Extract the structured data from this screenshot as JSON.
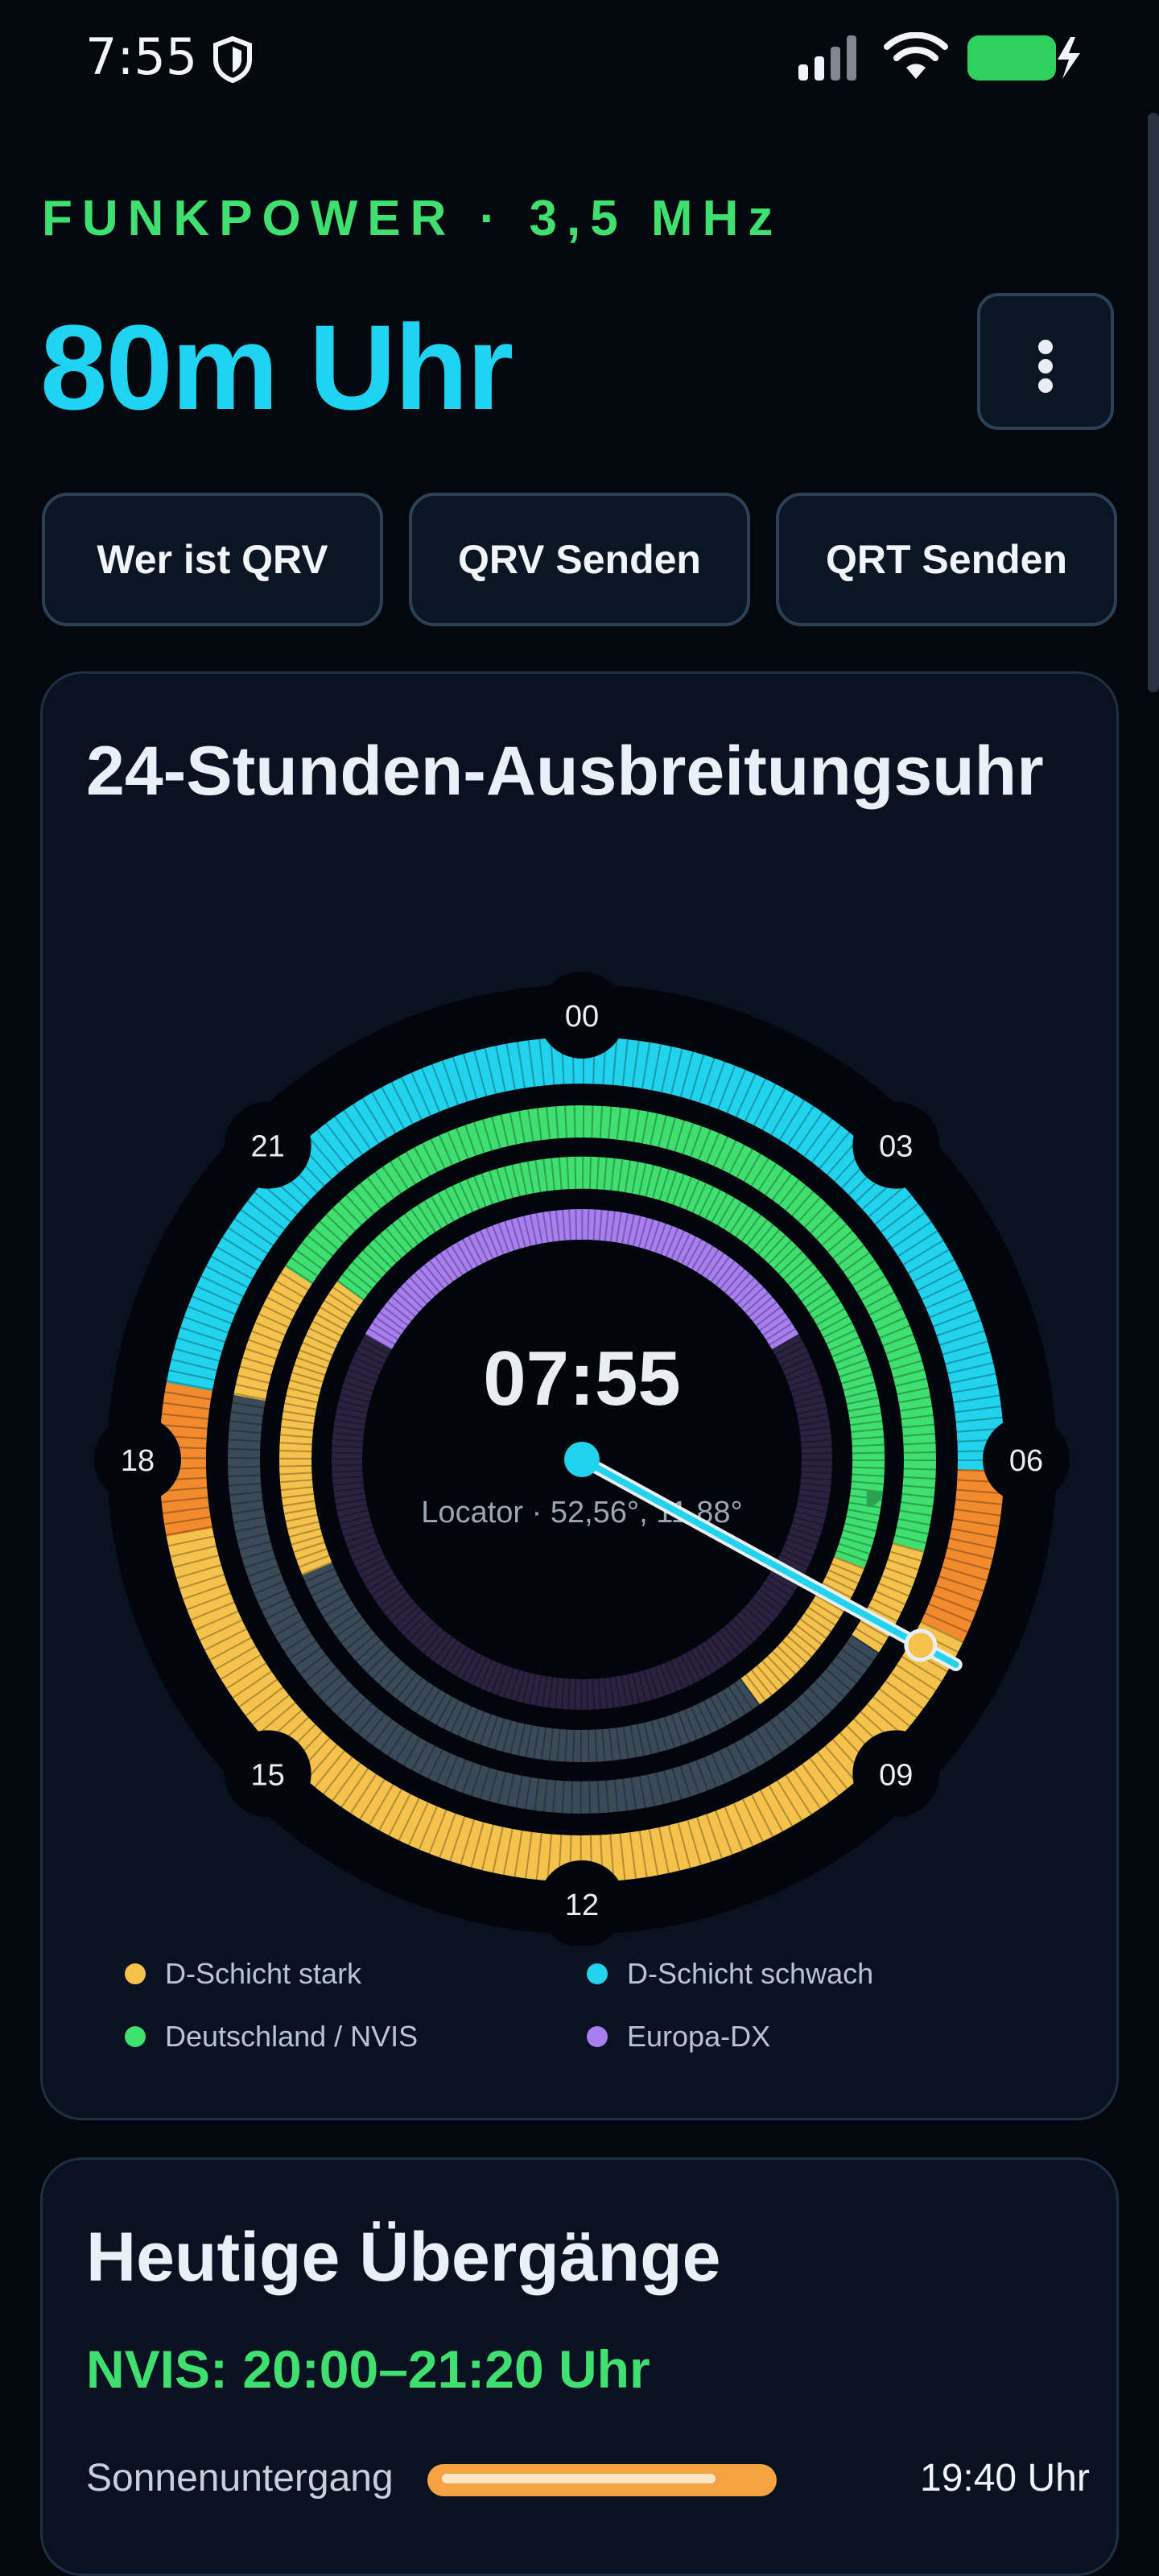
{
  "status_bar": {
    "time": "7:55",
    "icons": [
      "shield-icon",
      "signal-icon",
      "wifi-icon",
      "battery-charging-icon"
    ]
  },
  "header": {
    "eyebrow": "FUNKPOWER · 3,5 MHz",
    "title": "80m Uhr",
    "menu_icon": "more-vertical-icon"
  },
  "actions": [
    {
      "label": "Wer ist QRV"
    },
    {
      "label": "QRV Senden"
    },
    {
      "label": "QRT Senden"
    }
  ],
  "clock_card": {
    "title": "24-Stunden-Ausbreitungsuhr",
    "center_time": "07:55",
    "locator": "Locator · 52,56°, 11,88°",
    "hour_labels": [
      "00",
      "03",
      "06",
      "09",
      "12",
      "15",
      "18",
      "21"
    ],
    "needle_hour": 7.9167,
    "rings": [
      {
        "name": "D-Schicht-ring",
        "segments": [
          {
            "from": 18.7,
            "to": 6.1,
            "color": "#22d3ee"
          },
          {
            "from": 6.1,
            "to": 7.7,
            "color": "#f28a2e"
          },
          {
            "from": 7.7,
            "to": 17.3,
            "color": "#f5c34b"
          },
          {
            "from": 17.3,
            "to": 18.7,
            "color": "#f28a2e"
          }
        ]
      },
      {
        "name": "Deutschland-NVIS-ring",
        "segments": [
          {
            "from": 20.2,
            "to": 7.0,
            "color": "#3fe06f"
          },
          {
            "from": 7.0,
            "to": 8.2,
            "color": "#f5c34b"
          },
          {
            "from": 8.2,
            "to": 17.4,
            "color": "#3a4a59"
          },
          {
            "from": 17.4,
            "to": 18.7,
            "color": "#3a4a59"
          },
          {
            "from": 18.7,
            "to": 20.2,
            "color": "#f5c34b"
          }
        ]
      },
      {
        "name": "Inland-ring",
        "segments": [
          {
            "from": 20.4,
            "to": 7.4,
            "color": "#3fe06f"
          },
          {
            "from": 7.4,
            "to": 9.6,
            "color": "#f5c34b"
          },
          {
            "from": 9.6,
            "to": 16.5,
            "color": "#3a4a59"
          },
          {
            "from": 16.5,
            "to": 20.4,
            "color": "#f5c34b"
          }
        ]
      },
      {
        "name": "Europa-DX-ring",
        "segments": [
          {
            "from": 20.0,
            "to": 4.0,
            "color": "#a77ff0"
          },
          {
            "from": 4.0,
            "to": 20.0,
            "color": "#2b2140"
          }
        ]
      }
    ],
    "legend": [
      {
        "label": "D-Schicht stark",
        "color": "#f5c34b"
      },
      {
        "label": "D-Schicht schwach",
        "color": "#22d3ee"
      },
      {
        "label": "Deutschland / NVIS",
        "color": "#3fe06f"
      },
      {
        "label": "Europa-DX",
        "color": "#a77ff0"
      }
    ]
  },
  "transitions_card": {
    "title": "Heutige Übergänge",
    "nvis": "NVIS: 20:00–21:20 Uhr",
    "rows": [
      {
        "label": "Sonnenuntergang",
        "value": "19:40 Uhr",
        "bar_color": "#f4a340",
        "bar_fill": 0.85
      }
    ]
  }
}
